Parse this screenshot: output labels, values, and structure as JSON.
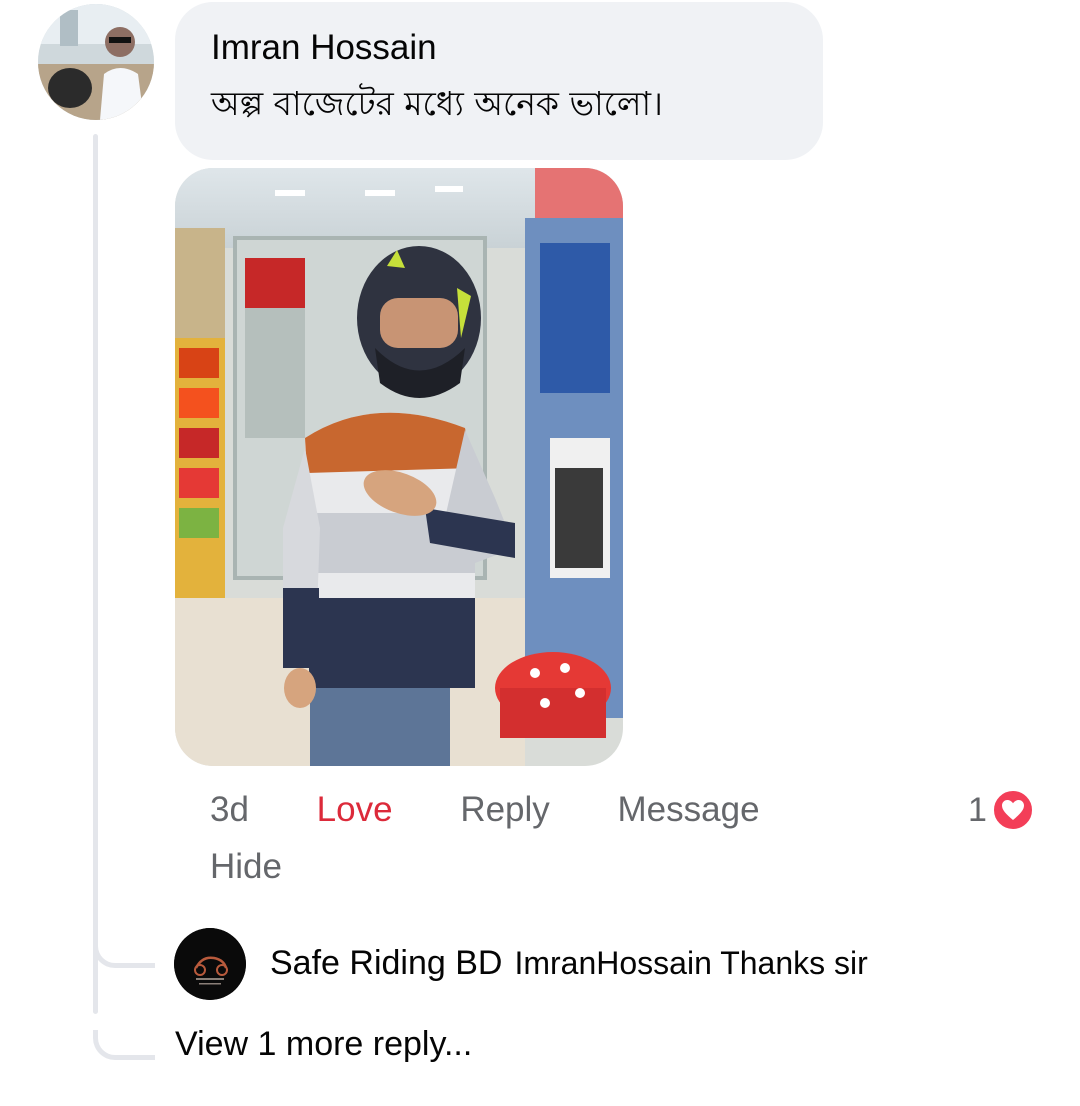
{
  "comment": {
    "author": "Imran Hossain",
    "text": "অল্প বাজেটের মধ্যে অনেক ভালো।",
    "avatar": "user-avatar-photo",
    "attachment": "photo-man-in-helmet"
  },
  "actions": {
    "time": "3d",
    "love": "Love",
    "reply": "Reply",
    "message": "Message",
    "hide": "Hide"
  },
  "reactions": {
    "count": "1",
    "icon": "heart-icon",
    "color": "#f33e58"
  },
  "reply": {
    "author": "Safe Riding BD",
    "text": "ImranHossain Thanks sir",
    "avatar": "safe-riding-bd-logo"
  },
  "view_more": "View 1 more reply...",
  "colors": {
    "love_active": "#dc2a3a",
    "muted": "#65676b",
    "bubble": "#f0f2f5"
  }
}
